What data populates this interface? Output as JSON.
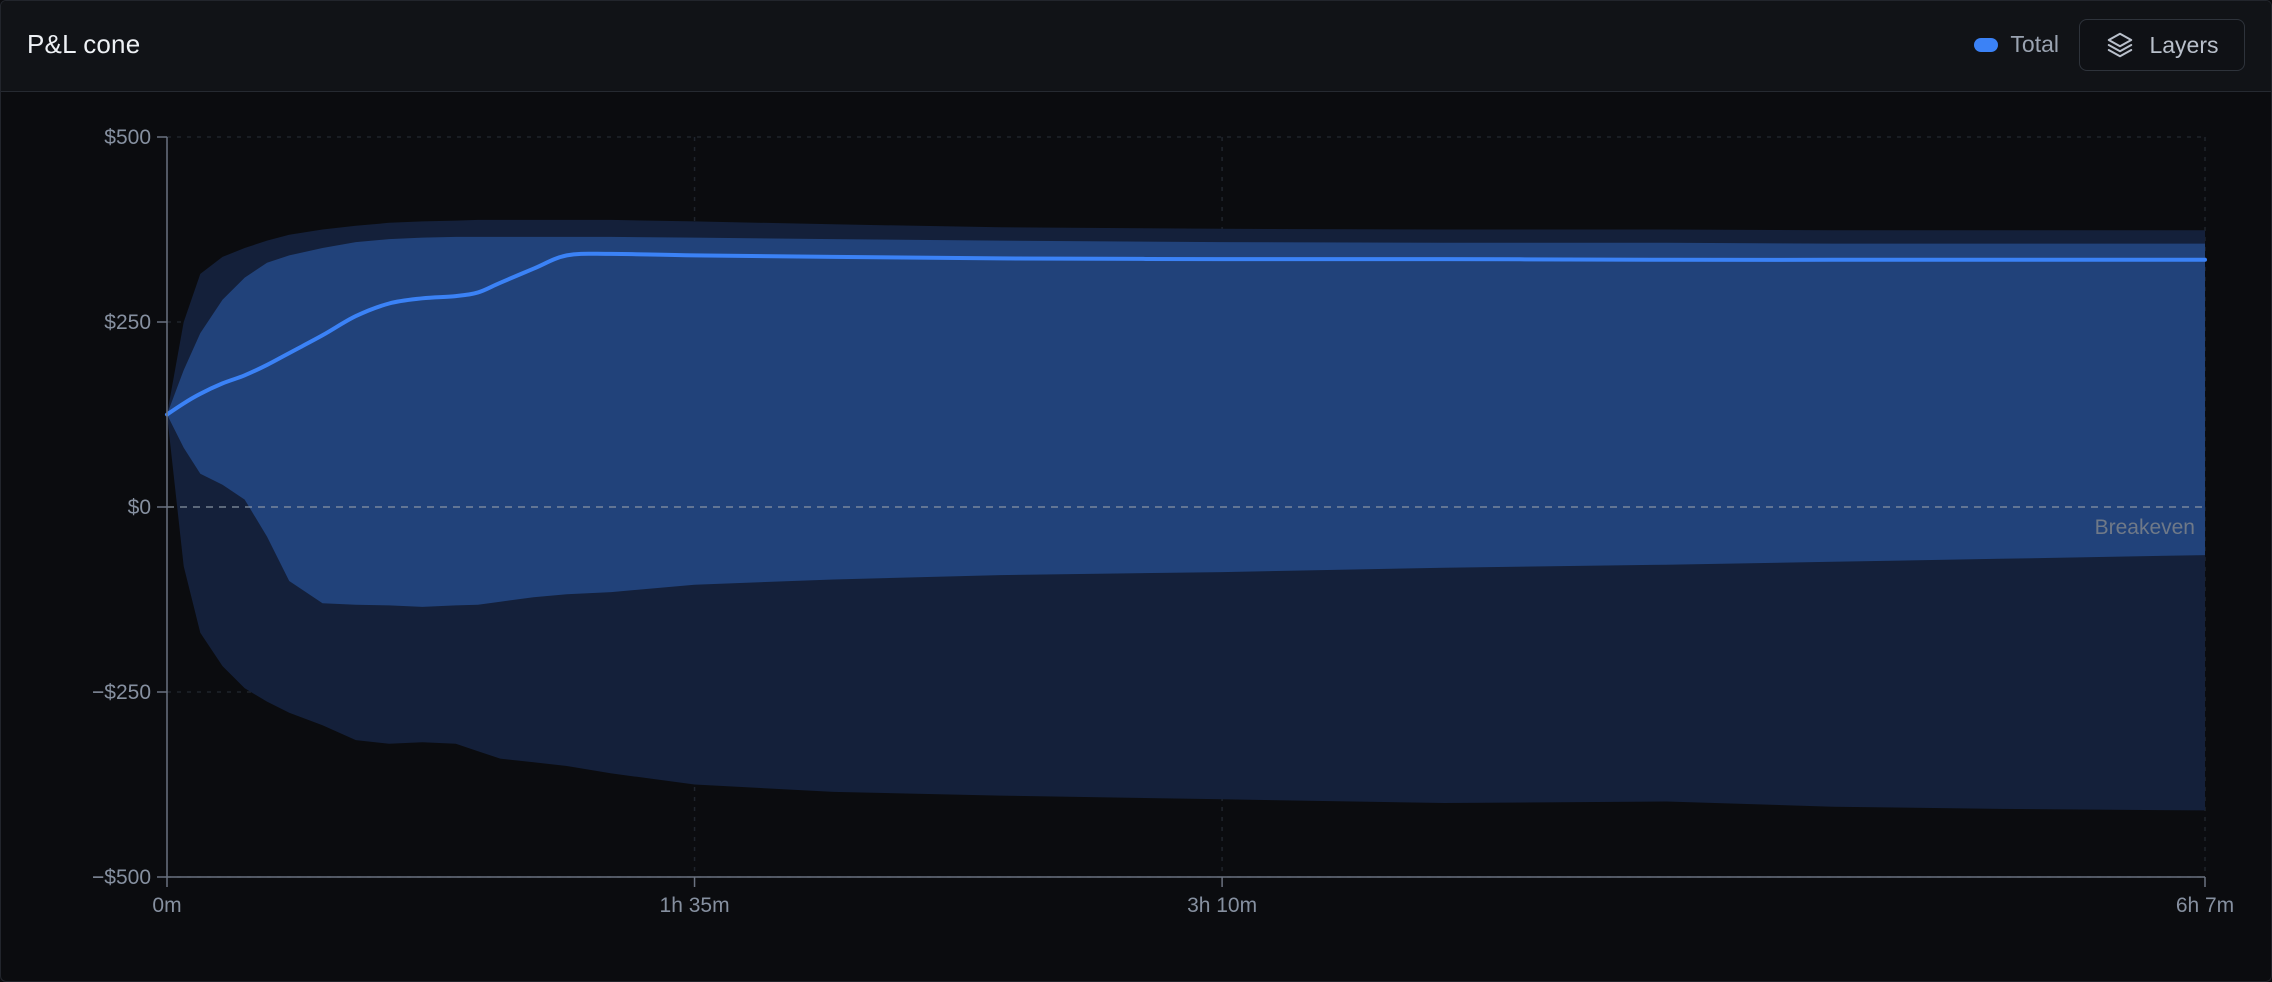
{
  "panel": {
    "title": "P&L cone"
  },
  "legend": {
    "label": "Total",
    "color": "#3b82f6"
  },
  "layers_button": {
    "label": "Layers",
    "icon": "layers-icon"
  },
  "colors": {
    "outer_band": "#14203a",
    "inner_band": "#21427a",
    "line": "#3b82f6",
    "axis": "#6b7280",
    "grid": "#1f242c"
  },
  "chart_data": {
    "type": "area",
    "title": "P&L cone",
    "xlabel": "",
    "ylabel": "",
    "ylim": [
      -500,
      500
    ],
    "xlim": [
      0,
      367
    ],
    "y_ticks": [
      {
        "value": 500,
        "label": "$500"
      },
      {
        "value": 250,
        "label": "$250"
      },
      {
        "value": 0,
        "label": "$0"
      },
      {
        "value": -250,
        "label": "−$250"
      },
      {
        "value": -500,
        "label": "−$500"
      }
    ],
    "x_ticks": [
      {
        "value": 0,
        "label": "0m"
      },
      {
        "value": 95,
        "label": "1h 35m"
      },
      {
        "value": 190,
        "label": "3h 10m"
      },
      {
        "value": 367,
        "label": "6h 7m"
      }
    ],
    "grid": true,
    "legend_position": "top-right",
    "annotations": [
      {
        "y": 0,
        "label": "Breakeven",
        "style": "dashed"
      }
    ],
    "x": [
      0,
      3,
      6,
      10,
      14,
      18,
      22,
      28,
      34,
      40,
      46,
      52,
      56,
      60,
      66,
      72,
      80,
      95,
      120,
      150,
      190,
      230,
      270,
      300,
      330,
      367
    ],
    "series": [
      {
        "name": "Total",
        "role": "median",
        "values": [
          125,
          140,
          153,
          167,
          178,
          192,
          208,
          232,
          258,
          275,
          282,
          285,
          290,
          303,
          322,
          340,
          342,
          340,
          338,
          336,
          335,
          335,
          334,
          334,
          334,
          334
        ]
      },
      {
        "role": "inner-upper",
        "values": [
          125,
          185,
          235,
          280,
          310,
          330,
          340,
          350,
          358,
          362,
          364,
          365,
          365,
          365,
          365,
          365,
          365,
          364,
          362,
          360,
          358,
          357,
          357,
          356,
          356,
          356
        ]
      },
      {
        "role": "inner-lower",
        "values": [
          125,
          80,
          45,
          30,
          10,
          -40,
          -100,
          -130,
          -132,
          -133,
          -135,
          -133,
          -132,
          -128,
          -122,
          -118,
          -115,
          -105,
          -98,
          -92,
          -88,
          -82,
          -78,
          -74,
          -70,
          -65
        ]
      },
      {
        "role": "outer-upper",
        "values": [
          125,
          250,
          315,
          338,
          350,
          360,
          368,
          375,
          380,
          384,
          386,
          387,
          388,
          388,
          388,
          388,
          388,
          386,
          382,
          378,
          376,
          375,
          375,
          374,
          374,
          374
        ]
      },
      {
        "role": "outer-lower",
        "values": [
          125,
          -80,
          -170,
          -215,
          -245,
          -263,
          -278,
          -295,
          -315,
          -320,
          -318,
          -320,
          -330,
          -340,
          -345,
          -350,
          -360,
          -375,
          -385,
          -390,
          -395,
          -400,
          -398,
          -405,
          -408,
          -410
        ]
      }
    ]
  }
}
